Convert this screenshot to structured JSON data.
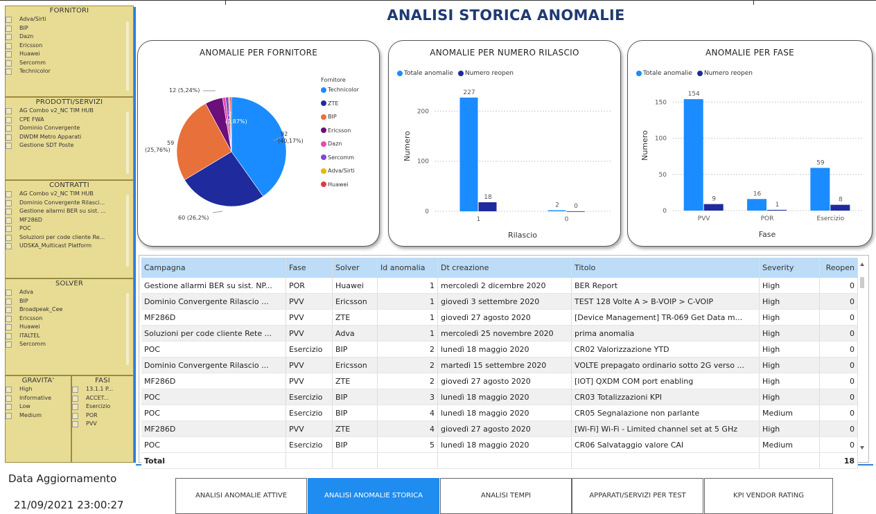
{
  "title": "ANALISI STORICA ANOMALIE",
  "colors": {
    "accent": "#1f8cf0",
    "panel": "#e8dc94",
    "title": "#1f3b73"
  },
  "filters": {
    "fornitori": {
      "title": "FORNITORI",
      "items": [
        "Adva/Sirti",
        "BIP",
        "Dazn",
        "Ericsson",
        "Huawei",
        "Sercomm",
        "Technicolor"
      ]
    },
    "prodotti": {
      "title": "PRODOTTI/SERVIZI",
      "items": [
        "AG Combo v2_NC TIM HUB",
        "CPE FWA",
        "Dominio Convergente",
        "DWDM Metro Apparati",
        "Gestione SDT Poste"
      ]
    },
    "contratti": {
      "title": "CONTRATTI",
      "items": [
        "AG Combo v2_NC TIM HUB",
        "Dominio Convergente Rilasci...",
        "Gestione allarmi BER su sist. ...",
        "MF286D",
        "POC",
        "Soluzioni per code cliente Re...",
        "UDSKA_Multicast Platform"
      ]
    },
    "solver": {
      "title": "SOLVER",
      "items": [
        "Adva",
        "BIP",
        "Broadpeak_Cee",
        "Ericsson",
        "Huawei",
        "ITALTEL",
        "Sercomm"
      ]
    },
    "gravita": {
      "title": "GRAVITA'",
      "items": [
        "High",
        "Informative",
        "Low",
        "Medium"
      ]
    },
    "fasi": {
      "title": "FASI",
      "items": [
        "13.1.1 P...",
        "ACCET...",
        "Esercizio",
        "POR",
        "PVV"
      ]
    }
  },
  "update": {
    "label": "Data Aggiornamento",
    "value": "21/09/2021 23:00:27"
  },
  "charts": {
    "pie": {
      "title": "ANOMALIE PER FORNITORE",
      "legend_title": "Fornitore",
      "legend": [
        {
          "name": "Technicolor",
          "color": "#1a8cff"
        },
        {
          "name": "ZTE",
          "color": "#1f2a9c"
        },
        {
          "name": "BIP",
          "color": "#e8703a"
        },
        {
          "name": "Ericsson",
          "color": "#6b0f7a"
        },
        {
          "name": "Dazn",
          "color": "#e84aa8"
        },
        {
          "name": "Sercomm",
          "color": "#7c4ad6"
        },
        {
          "name": "Adva/Sirti",
          "color": "#e6b800"
        },
        {
          "name": "Huawei",
          "color": "#e03a4a"
        }
      ],
      "labels": {
        "l1": "92",
        "l1b": "(40,17%)",
        "l2": "60 (26,2%)",
        "l3": "59",
        "l3b": "(25,76%)",
        "l4": "12 (5,24%)",
        "l5": "2",
        "l5b": "(0,87%)"
      }
    },
    "rilascio": {
      "title": "ANOMALIE PER NUMERO RILASCIO",
      "legend": [
        "Totale anomalie",
        "Numero reopen"
      ],
      "ylabel": "Numero",
      "xlabel": "Rilascio",
      "yticks": [
        "0",
        "100",
        "200"
      ]
    },
    "fase": {
      "title": "ANOMALIE PER FASE",
      "legend": [
        "Totale anomalie",
        "Numero reopen"
      ],
      "ylabel": "Numero",
      "xlabel": "Fase",
      "yticks": [
        "0",
        "50",
        "100",
        "150"
      ]
    }
  },
  "chart_data": [
    {
      "type": "pie",
      "title": "ANOMALIE PER FORNITORE",
      "categories": [
        "Technicolor",
        "ZTE",
        "BIP",
        "Ericsson",
        "Dazn",
        "Sercomm",
        "Adva/Sirti",
        "Huawei"
      ],
      "values": [
        92,
        60,
        59,
        12,
        2,
        2,
        1,
        1
      ]
    },
    {
      "type": "bar",
      "title": "ANOMALIE PER NUMERO RILASCIO",
      "categories": [
        "1",
        "0"
      ],
      "series": [
        {
          "name": "Totale anomalie",
          "values": [
            227,
            2
          ]
        },
        {
          "name": "Numero reopen",
          "values": [
            18,
            0
          ]
        }
      ],
      "xlabel": "Rilascio",
      "ylabel": "Numero",
      "ylim": [
        0,
        260
      ]
    },
    {
      "type": "bar",
      "title": "ANOMALIE PER FASE",
      "categories": [
        "PVV",
        "POR",
        "Esercizio"
      ],
      "series": [
        {
          "name": "Totale anomalie",
          "values": [
            154,
            16,
            59
          ]
        },
        {
          "name": "Numero reopen",
          "values": [
            9,
            1,
            8
          ]
        }
      ],
      "xlabel": "Fase",
      "ylabel": "Numero",
      "ylim": [
        0,
        180
      ]
    }
  ],
  "table": {
    "headers": [
      "Campagna",
      "Fase",
      "Solver",
      "Id anomalia",
      "Dt creazione",
      "Titolo",
      "Severity",
      "Reopen"
    ],
    "rows": [
      [
        "Gestione allarmi BER su sist. NP...",
        "POR",
        "Huawei",
        "1",
        "mercoledì 2 dicembre 2020",
        "BER Report",
        "High",
        "0"
      ],
      [
        "Dominio Convergente Rilascio ...",
        "PVV",
        "Ericsson",
        "1",
        "giovedì 3 settembre 2020",
        "TEST 128 Volte A > B-VOIP > C-VOIP",
        "High",
        "0"
      ],
      [
        "MF286D",
        "PVV",
        "ZTE",
        "1",
        "giovedì 27 agosto 2020",
        "[Device Management] TR-069 Get Data m...",
        "High",
        "0"
      ],
      [
        "Soluzioni per code cliente Rete ...",
        "PVV",
        "Adva",
        "1",
        "mercoledì 25 novembre 2020",
        "prima anomalia",
        "High",
        "0"
      ],
      [
        "POC",
        "Esercizio",
        "BIP",
        "2",
        "lunedì 18 maggio 2020",
        "CR02 Valorizzazione YTD",
        "High",
        "0"
      ],
      [
        "Dominio Convergente Rilascio ...",
        "PVV",
        "Ericsson",
        "2",
        "martedì 15 settembre 2020",
        "VOLTE prepagato ordinario sotto 2G verso ...",
        "High",
        "0"
      ],
      [
        "MF286D",
        "PVV",
        "ZTE",
        "2",
        "giovedì 27 agosto 2020",
        "[IOT] QXDM COM port enabling",
        "High",
        "0"
      ],
      [
        "POC",
        "Esercizio",
        "BIP",
        "3",
        "lunedì 18 maggio 2020",
        "CR03 Totalizzazioni KPI",
        "High",
        "0"
      ],
      [
        "POC",
        "Esercizio",
        "BIP",
        "4",
        "lunedì 18 maggio 2020",
        "CR05 Segnalazione non parlante",
        "Medium",
        "0"
      ],
      [
        "MF286D",
        "PVV",
        "ZTE",
        "4",
        "giovedì 27 agosto 2020",
        "[Wi-Fi] Wi-Fi - Limited channel set at 5 GHz",
        "High",
        "0"
      ],
      [
        "POC",
        "Esercizio",
        "BIP",
        "5",
        "lunedì 18 maggio 2020",
        "CR06 Salvataggio valore CAI",
        "Medium",
        "0"
      ]
    ],
    "total_label": "Total",
    "total_value": "18"
  },
  "nav": [
    {
      "label": "ANALISI ANOMALIE ATTIVE",
      "active": false
    },
    {
      "label": "ANALISI ANOMALIE STORICA",
      "active": true
    },
    {
      "label": "ANALISI TEMPI",
      "active": false
    },
    {
      "label": "APPARATI/SERVIZI PER TEST",
      "active": false
    },
    {
      "label": "KPI VENDOR RATING",
      "active": false
    }
  ]
}
